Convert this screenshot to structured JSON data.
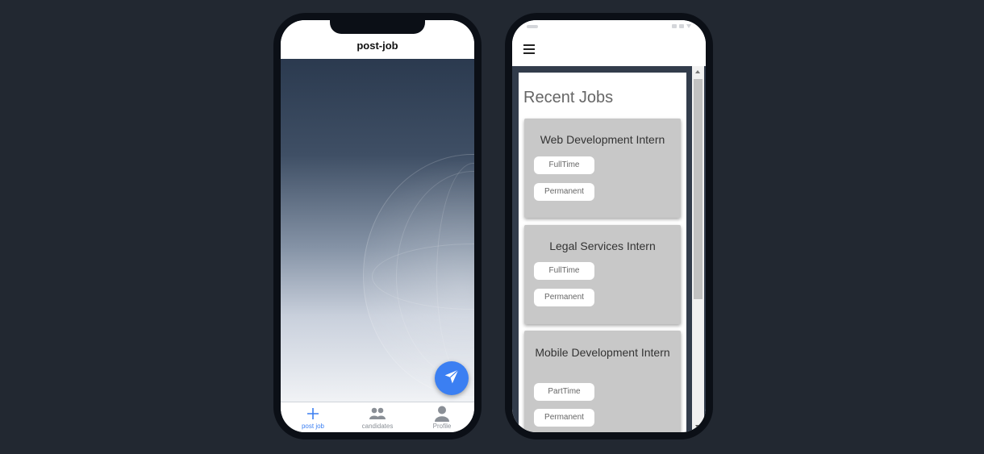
{
  "post_job_screen": {
    "title": "post-job",
    "fab_icon": "send-icon",
    "accent_color": "#3b7ff2",
    "tabs": [
      {
        "label": "post job",
        "icon": "plus-icon",
        "active": true
      },
      {
        "label": "candidates",
        "icon": "people-icon",
        "active": false
      },
      {
        "label": "Profile",
        "icon": "person-icon",
        "active": false
      }
    ]
  },
  "jobs_screen": {
    "menu_icon": "hamburger-icon",
    "heading": "Recent Jobs",
    "jobs": [
      {
        "title": "Web Development Intern",
        "chips": [
          "FullTime",
          "Permanent"
        ]
      },
      {
        "title": "Legal Services Intern",
        "chips": [
          "FullTime",
          "Permanent"
        ]
      },
      {
        "title": "Mobile Development Intern",
        "chips": [
          "PartTime",
          "Permanent"
        ]
      }
    ]
  }
}
